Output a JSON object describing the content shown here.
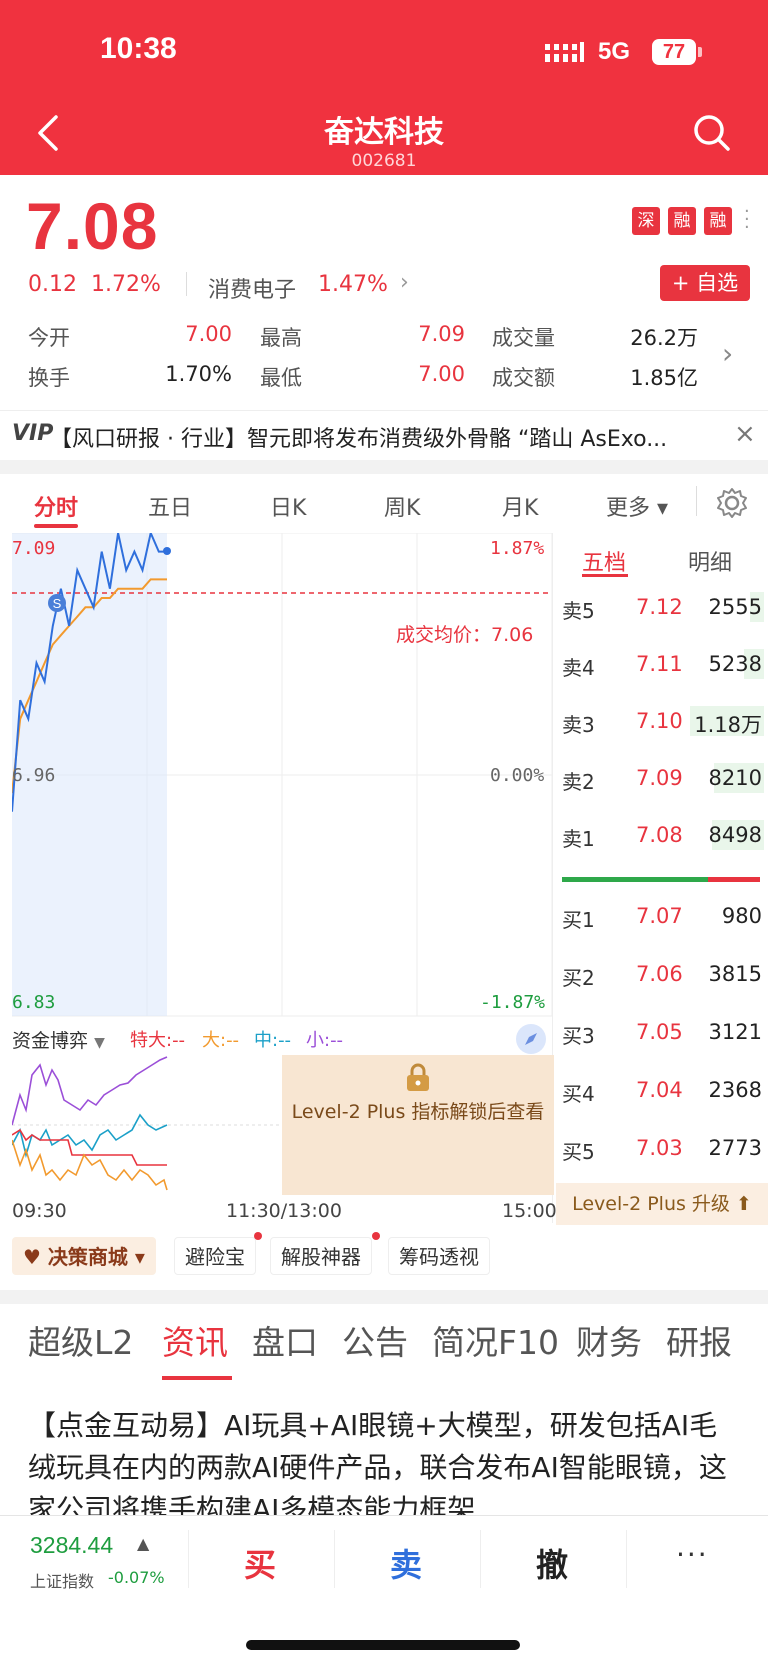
{
  "status_bar": {
    "time": "10:38",
    "network": "5G",
    "battery": "77"
  },
  "header": {
    "title": "奋达科技",
    "code": "002681"
  },
  "quote": {
    "price": "7.08",
    "change": "0.12",
    "change_pct": "1.72%",
    "sector_name": "消费电子",
    "sector_pct": "1.47%",
    "tags": [
      "深",
      "融",
      "融"
    ],
    "watch_button": "+ 自选"
  },
  "stats": {
    "open_label": "今开",
    "open": "7.00",
    "high_label": "最高",
    "high": "7.09",
    "volume_label": "成交量",
    "volume": "26.2万",
    "turnover_label": "换手",
    "turnover": "1.70%",
    "low_label": "最低",
    "low": "7.00",
    "amount_label": "成交额",
    "amount": "1.85亿"
  },
  "vip_banner": {
    "logo": "VIP",
    "text": "【风口研报 · 行业】智元即将发布消费级外骨骼 “踏山 AsExo..."
  },
  "chart_tabs": [
    "分时",
    "五日",
    "日K",
    "周K",
    "月K",
    "更多"
  ],
  "chart": {
    "price_top": "7.09",
    "price_mid": "6.96",
    "price_bot": "6.83",
    "pct_top": "1.87%",
    "pct_mid": "0.00%",
    "pct_bot": "-1.87%",
    "avg_label": "成交均价：7.06",
    "times": [
      "09:30",
      "11:30/13:00",
      "15:00"
    ]
  },
  "chart_data": {
    "type": "line",
    "ylim": [
      6.83,
      7.09
    ],
    "series": [
      {
        "values": [
          6.94,
          7.0,
          6.99,
          7.02,
          7.01,
          7.04,
          7.06,
          7.04,
          7.07,
          7.06,
          7.05,
          7.08,
          7.06,
          7.09,
          7.07,
          7.08,
          7.07,
          7.09,
          7.08,
          7.08
        ]
      },
      {
        "values": [
          6.95,
          6.99,
          7.0,
          7.01,
          7.02,
          7.03,
          7.035,
          7.04,
          7.045,
          7.05,
          7.05,
          7.055,
          7.055,
          7.06,
          7.06,
          7.06,
          7.06,
          7.065,
          7.065,
          7.065
        ]
      }
    ]
  },
  "order_book": {
    "tabs": [
      "五档",
      "明细"
    ],
    "asks": [
      {
        "label": "卖5",
        "price": "7.12",
        "vol": "2555"
      },
      {
        "label": "卖4",
        "price": "7.11",
        "vol": "5238"
      },
      {
        "label": "卖3",
        "price": "7.10",
        "vol": "1.18万"
      },
      {
        "label": "卖2",
        "price": "7.09",
        "vol": "8210"
      },
      {
        "label": "卖1",
        "price": "7.08",
        "vol": "8498"
      }
    ],
    "bids": [
      {
        "label": "买1",
        "price": "7.07",
        "vol": "980"
      },
      {
        "label": "买2",
        "price": "7.06",
        "vol": "3815"
      },
      {
        "label": "买3",
        "price": "7.05",
        "vol": "3121"
      },
      {
        "label": "买4",
        "price": "7.04",
        "vol": "2368"
      },
      {
        "label": "买5",
        "price": "7.03",
        "vol": "2773"
      }
    ],
    "upgrade": "Level-2 Plus 升级"
  },
  "fund_flow": {
    "title": "资金博弈",
    "legend": [
      "特大:--",
      "大:--",
      "中:--",
      "小:--"
    ],
    "lock_text": "Level-2 Plus 指标解锁后查看"
  },
  "tools": [
    "决策商城",
    "避险宝",
    "解股神器",
    "筹码透视"
  ],
  "news_tabs": [
    "超级L2",
    "资讯",
    "盘口",
    "公告",
    "简况F10",
    "财务",
    "研报"
  ],
  "news_text": "【点金互动易】AI玩具+AI眼镜+大模型，研发包括AI毛绒玩具在内的两款AI硬件产品，联合发布AI智能眼镜，这家公司将携手构建AI多模态能力框架",
  "bottom": {
    "index_value": "3284.44",
    "index_name": "上证指数",
    "index_change": "-0.07%",
    "buy": "买",
    "sell": "卖",
    "cancel": "撤",
    "more": "···"
  },
  "colors": {
    "header": "#f0323f",
    "up": "#e8343f",
    "down": "#1e9d3f",
    "price_line": "#2f6fdc",
    "avg_line": "#f29a2e"
  }
}
